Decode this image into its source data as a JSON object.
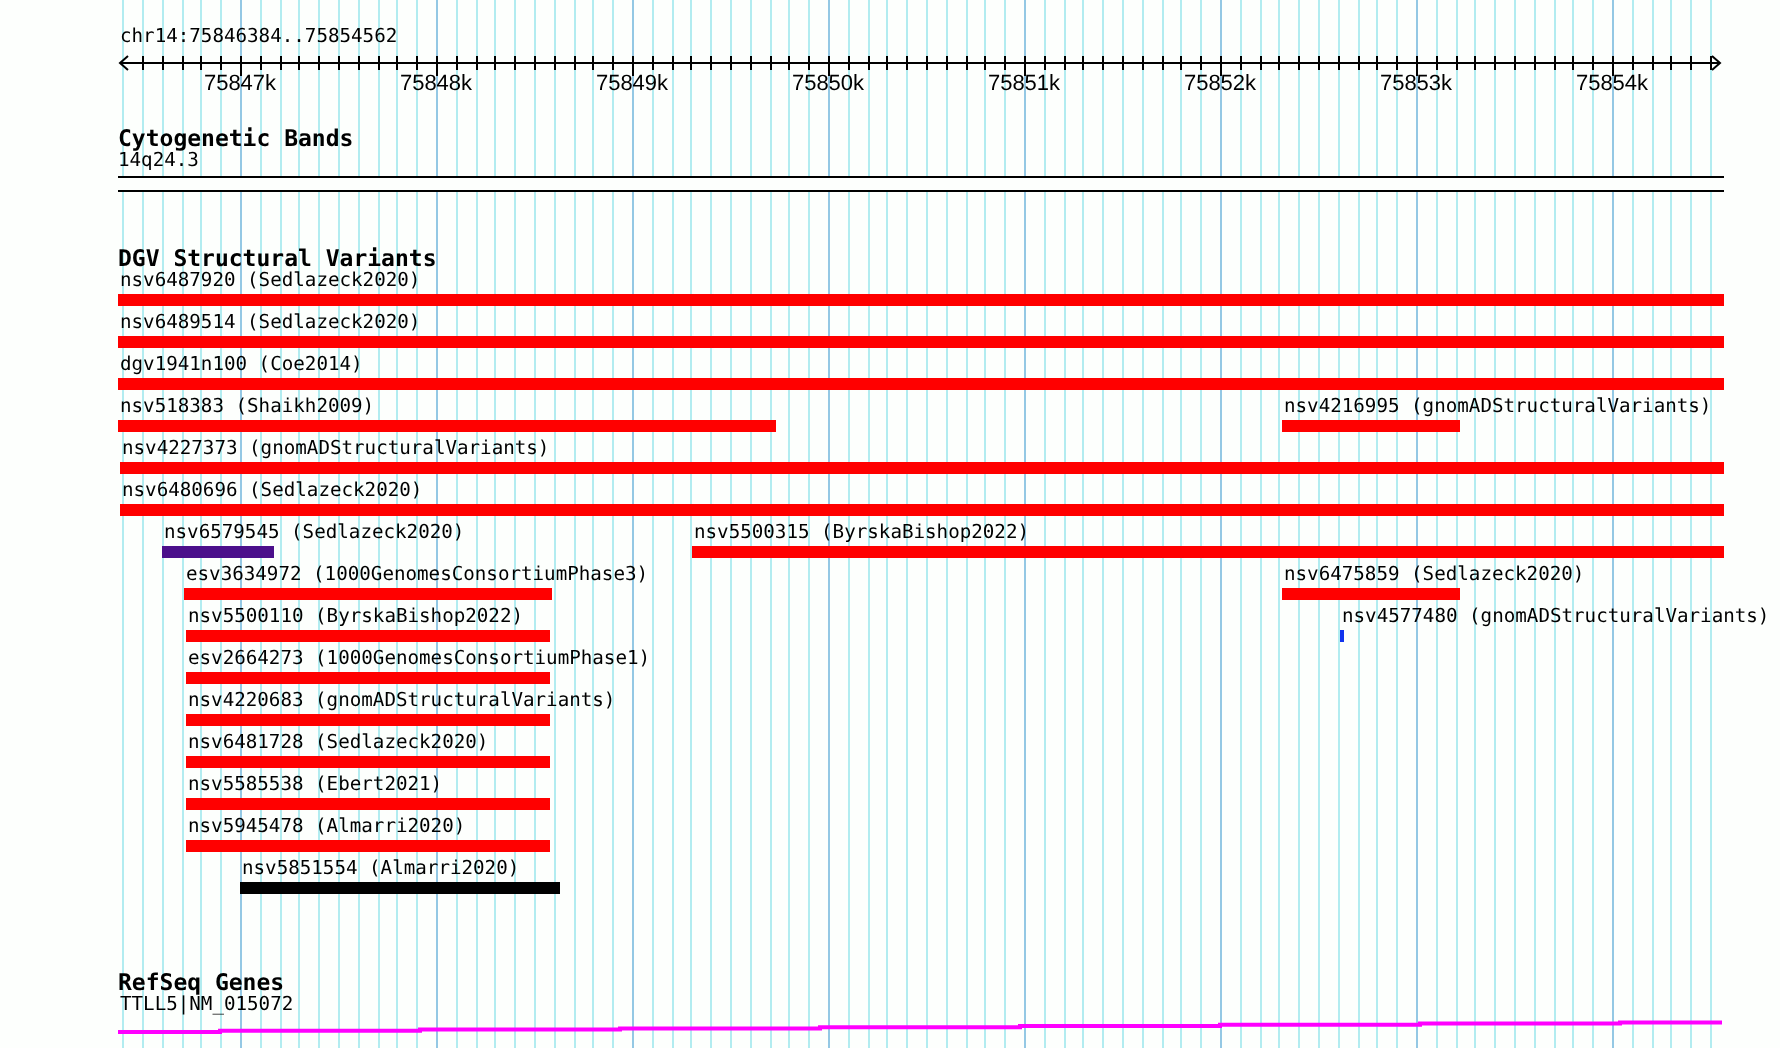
{
  "locus": "chr14:75846384..75854562",
  "ruler": {
    "ticks": [
      "75847k",
      "75848k",
      "75849k",
      "75850k",
      "75851k",
      "75852k",
      "75853k",
      "75854k"
    ]
  },
  "cytoband_track": {
    "title": "Cytogenetic Bands",
    "band": "14q24.3"
  },
  "variant_track": {
    "title": "DGV Structural Variants",
    "rows": [
      {
        "features": [
          {
            "label": "nsv6487920 (Sedlazeck2020)",
            "color": "#ff0000"
          }
        ]
      },
      {
        "features": [
          {
            "label": "nsv6489514 (Sedlazeck2020)",
            "color": "#ff0000"
          }
        ]
      },
      {
        "features": [
          {
            "label": "dgv1941n100 (Coe2014)",
            "color": "#ff0000"
          }
        ]
      },
      {
        "features": [
          {
            "label": "nsv518383 (Shaikh2009)",
            "color": "#ff0000"
          },
          {
            "label": "nsv4216995 (gnomADStructuralVariants)",
            "color": "#ff0000"
          }
        ]
      },
      {
        "features": [
          {
            "label": "nsv4227373 (gnomADStructuralVariants)",
            "color": "#ff0000"
          }
        ]
      },
      {
        "features": [
          {
            "label": "nsv6480696 (Sedlazeck2020)",
            "color": "#ff0000"
          }
        ]
      },
      {
        "features": [
          {
            "label": "nsv6579545 (Sedlazeck2020)",
            "color": "#4b0f8b"
          },
          {
            "label": "nsv5500315 (ByrskaBishop2022)",
            "color": "#ff0000"
          }
        ]
      },
      {
        "features": [
          {
            "label": "esv3634972 (1000GenomesConsortiumPhase3)",
            "color": "#ff0000"
          },
          {
            "label": "nsv6475859 (Sedlazeck2020)",
            "color": "#ff0000"
          }
        ]
      },
      {
        "features": [
          {
            "label": "nsv5500110 (ByrskaBishop2022)",
            "color": "#ff0000"
          },
          {
            "label": "nsv4577480 (gnomADStructuralVariants)",
            "color": "#1133ee"
          }
        ]
      },
      {
        "features": [
          {
            "label": "esv2664273 (1000GenomesConsortiumPhase1)",
            "color": "#ff0000"
          }
        ]
      },
      {
        "features": [
          {
            "label": "nsv4220683 (gnomADStructuralVariants)",
            "color": "#ff0000"
          }
        ]
      },
      {
        "features": [
          {
            "label": "nsv6481728 (Sedlazeck2020)",
            "color": "#ff0000"
          }
        ]
      },
      {
        "features": [
          {
            "label": "nsv5585538 (Ebert2021)",
            "color": "#ff0000"
          }
        ]
      },
      {
        "features": [
          {
            "label": "nsv5945478 (Almarri2020)",
            "color": "#ff0000"
          }
        ]
      },
      {
        "features": [
          {
            "label": "nsv5851554 (Almarri2020)",
            "color": "#000000"
          }
        ]
      }
    ]
  },
  "gene_track": {
    "title": "RefSeq Genes",
    "gene": "TTLL5|NM_015072"
  }
}
